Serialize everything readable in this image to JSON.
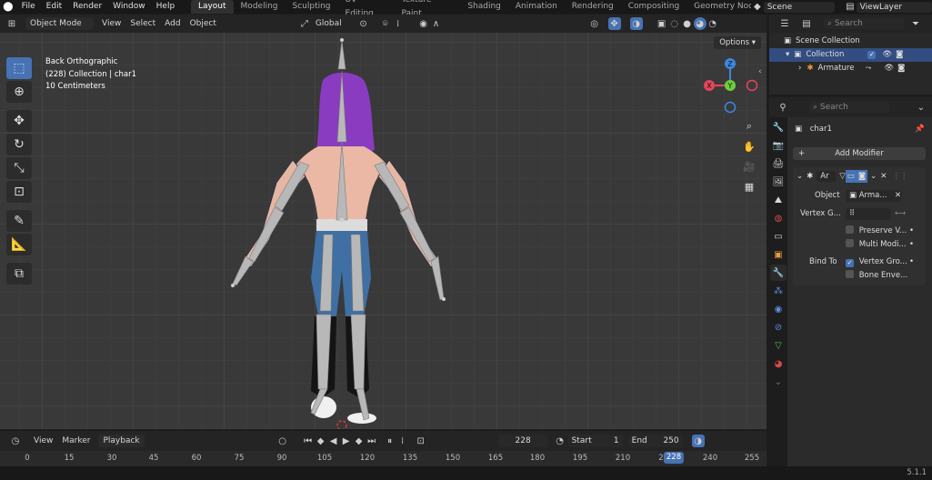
{
  "menu": [
    "File",
    "Edit",
    "Render",
    "Window",
    "Help"
  ],
  "workspaces": [
    "Layout",
    "Modeling",
    "Sculpting",
    "UV Editing",
    "Texture Paint",
    "Shading",
    "Animation",
    "Rendering",
    "Compositing",
    "Geometry Nodes"
  ],
  "active_workspace": "Layout",
  "scene": "Scene",
  "view_layer": "ViewLayer",
  "viewport_header": {
    "mode": "Object Mode",
    "menus": [
      "View",
      "Select",
      "Add",
      "Object"
    ],
    "transform": "Global",
    "options": "Options"
  },
  "viewport_info": {
    "view": "Back Orthographic",
    "collection": "(228) Collection | char1",
    "scale": "10 Centimeters"
  },
  "gizmo": {
    "x": "X",
    "y": "Y",
    "z": "Z"
  },
  "outliner": {
    "search_placeholder": "Search",
    "scene_collection": "Scene Collection",
    "collection": "Collection",
    "armature": "Armature"
  },
  "properties": {
    "search_placeholder": "Search",
    "object_name": "char1",
    "add_modifier": "Add Modifier",
    "modifier_name": "Ar",
    "object_label": "Object",
    "object_value": "Arma...",
    "vertex_group_label": "Vertex G...",
    "preserve_volume": "Preserve V...",
    "multi_modifier": "Multi Modi...",
    "bind_to_label": "Bind To",
    "bind_vertex_groups": "Vertex Gro...",
    "bind_bone_envelopes": "Bone Enve..."
  },
  "timeline": {
    "menus": [
      "View",
      "Marker",
      "Playback"
    ],
    "current_frame": "228",
    "start_label": "Start",
    "start": "1",
    "end_label": "End",
    "end": "250",
    "ticks": [
      "0",
      "15",
      "30",
      "45",
      "60",
      "75",
      "90",
      "105",
      "120",
      "135",
      "150",
      "165",
      "180",
      "195",
      "210",
      "2",
      "240",
      "255"
    ],
    "playhead": "228"
  },
  "version": "5.1.1",
  "colors": {
    "accent": "#4772b3",
    "gizmo_x": "#e5455a",
    "gizmo_y": "#6ccf3a",
    "gizmo_z": "#3d87e2"
  }
}
